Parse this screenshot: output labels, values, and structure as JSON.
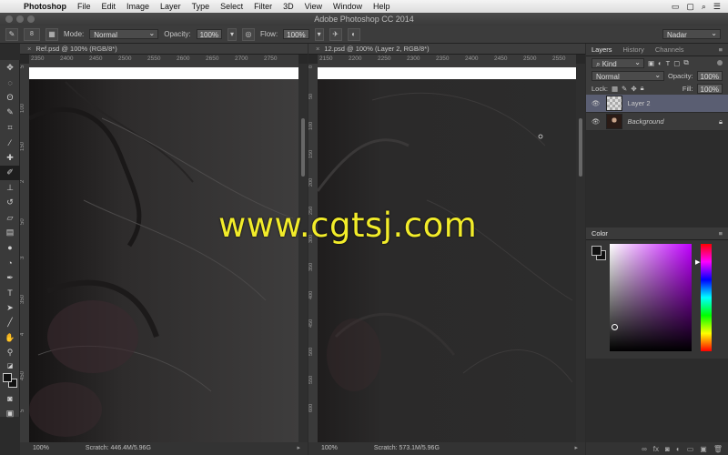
{
  "menubar": {
    "app_name": "Photoshop",
    "items": [
      "File",
      "Edit",
      "Image",
      "Layer",
      "Type",
      "Select",
      "Filter",
      "3D",
      "View",
      "Window",
      "Help"
    ]
  },
  "titlebar": {
    "title": "Adobe Photoshop CC 2014"
  },
  "options": {
    "brush_size": "8",
    "mode_label": "Mode:",
    "mode_value": "Normal",
    "opacity_label": "Opacity:",
    "opacity_value": "100%",
    "flow_label": "Flow:",
    "flow_value": "100%",
    "workspace": "Nadar"
  },
  "doc1": {
    "tab": "Ref.psd @ 100% (RGB/8*)",
    "ruler_h": [
      "2350",
      "2400",
      "2450",
      "2500",
      "2550",
      "2600",
      "2650",
      "2700",
      "2750"
    ],
    "ruler_v": [
      "5",
      "100",
      "150",
      "2",
      "50",
      "3",
      "350",
      "4",
      "450",
      "5"
    ],
    "zoom": "100%",
    "scratch": "Scratch: 446.4M/5.96G"
  },
  "doc2": {
    "tab": "12.psd @ 100% (Layer 2, RGB/8*)",
    "ruler_h": [
      "2150",
      "2200",
      "2250",
      "2300",
      "2350",
      "2400",
      "2450",
      "2500",
      "2550"
    ],
    "ruler_v": [
      "0",
      "50",
      "100",
      "150",
      "200",
      "250",
      "300",
      "350",
      "400",
      "450",
      "500",
      "550",
      "600"
    ],
    "zoom": "100%",
    "scratch": "Scratch: 573.1M/5.96G"
  },
  "watermark": "www.cgtsj.com",
  "layers_panel": {
    "tabs": [
      "Layers",
      "History",
      "Channels"
    ],
    "kind_label": "Kind",
    "blend_mode": "Normal",
    "opacity_label": "Opacity:",
    "opacity_value": "100%",
    "lock_label": "Lock:",
    "fill_label": "Fill:",
    "fill_value": "100%",
    "layers": [
      {
        "name": "Layer 2",
        "selected": true
      },
      {
        "name": "Background",
        "selected": false
      }
    ]
  },
  "color_panel": {
    "title": "Color"
  },
  "colors": {
    "watermark": "#f2ec2a",
    "selected_layer": "#5a5e72",
    "hue_base": "#c000ff"
  }
}
